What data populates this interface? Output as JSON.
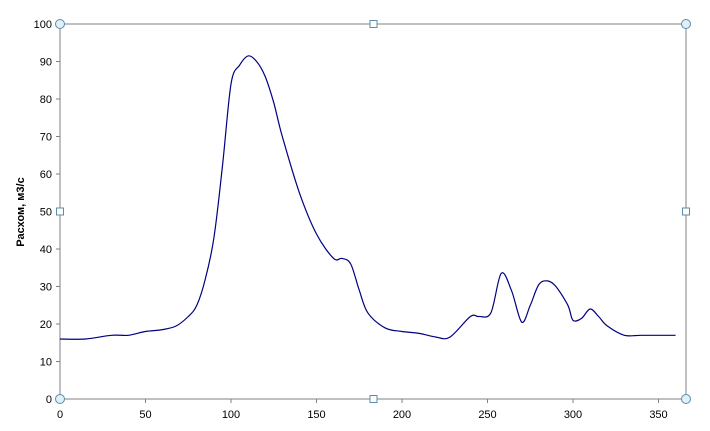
{
  "chart_data": {
    "type": "line",
    "title": "",
    "xlabel": "",
    "ylabel": "Расхом, м3/с",
    "xlim": [
      0,
      365
    ],
    "ylim": [
      0,
      100
    ],
    "x_ticks": [
      0,
      50,
      100,
      150,
      200,
      250,
      300,
      350
    ],
    "y_ticks": [
      0,
      10,
      20,
      30,
      40,
      50,
      60,
      70,
      80,
      90,
      100
    ],
    "grid": false,
    "legend": "none",
    "series": [
      {
        "color": "#000080",
        "x": [
          0,
          15,
          30,
          40,
          50,
          60,
          68,
          75,
          80,
          85,
          90,
          95,
          100,
          105,
          110,
          115,
          120,
          125,
          130,
          140,
          150,
          160,
          165,
          170,
          175,
          180,
          190,
          200,
          210,
          220,
          228,
          240,
          245,
          252,
          258,
          264,
          270,
          275,
          280,
          285,
          290,
          297,
          300,
          305,
          310,
          315,
          320,
          330,
          340,
          360
        ],
        "y": [
          16,
          16,
          17,
          17,
          18,
          18.5,
          19.5,
          22,
          25,
          32,
          43,
          62,
          84,
          89,
          91.5,
          90,
          86,
          79,
          70,
          55,
          44,
          37.5,
          37.5,
          36,
          29,
          23,
          19,
          18,
          17.5,
          16.5,
          16.5,
          22,
          22,
          23,
          33.5,
          29,
          20.5,
          25,
          30.5,
          31.5,
          30,
          25,
          21,
          21.5,
          24,
          22,
          19.5,
          17,
          17,
          17
        ]
      }
    ]
  }
}
